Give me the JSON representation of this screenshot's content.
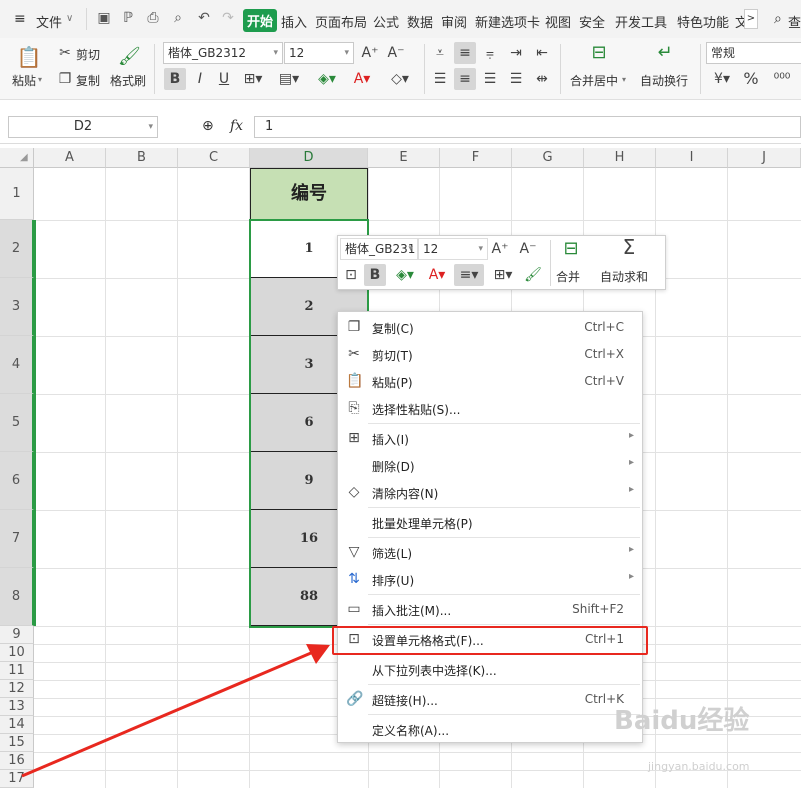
{
  "menubar": {
    "file_label": "文件",
    "tabs": [
      "开始",
      "插入",
      "页面布局",
      "公式",
      "数据",
      "审阅",
      "新建选项卡",
      "视图",
      "安全",
      "开发工具",
      "特色功能",
      "文"
    ],
    "active_tab": "开始",
    "search_label": "查"
  },
  "ribbon": {
    "paste_label": "粘贴",
    "cut_label": "剪切",
    "copy_label": "复制",
    "format_painter_label": "格式刷",
    "font_name": "楷体_GB2312",
    "font_size": "12",
    "merge_label": "合并居中",
    "wrap_label": "自动换行",
    "number_format": "常规",
    "percent_symbol": "%"
  },
  "formula_bar": {
    "name_box": "D2",
    "fx_label": "fx",
    "value": "1"
  },
  "sheet": {
    "columns": [
      "A",
      "B",
      "C",
      "D",
      "E",
      "F",
      "G",
      "H",
      "I",
      "J"
    ],
    "selected_column": "D",
    "header_cell": "编号",
    "d_values": [
      "1",
      "2",
      "3",
      "6",
      "9",
      "16",
      "88"
    ],
    "row_labels": [
      "1",
      "2",
      "3",
      "4",
      "5",
      "6",
      "7",
      "8",
      "9",
      "10",
      "11",
      "12",
      "13",
      "14",
      "15",
      "16",
      "17"
    ]
  },
  "mini_toolbar": {
    "font_name": "楷体_GB231",
    "font_size": "12",
    "merge_label": "合并",
    "autosum_label": "自动求和"
  },
  "context_menu": {
    "items": [
      {
        "label": "复制(C)",
        "shortcut": "Ctrl+C",
        "icon": "copy-icon"
      },
      {
        "label": "剪切(T)",
        "shortcut": "Ctrl+X",
        "icon": "scissors-icon"
      },
      {
        "label": "粘贴(P)",
        "shortcut": "Ctrl+V",
        "icon": "paste-icon"
      },
      {
        "label": "选择性粘贴(S)...",
        "shortcut": "",
        "icon": "paste-special-icon"
      },
      {
        "label": "插入(I)",
        "shortcut": "",
        "icon": "insert-icon"
      },
      {
        "label": "删除(D)",
        "shortcut": "",
        "icon": ""
      },
      {
        "label": "清除内容(N)",
        "shortcut": "",
        "icon": "eraser-icon"
      },
      {
        "label": "批量处理单元格(P)",
        "shortcut": "",
        "icon": ""
      },
      {
        "label": "筛选(L)",
        "shortcut": "",
        "icon": "filter-icon"
      },
      {
        "label": "排序(U)",
        "shortcut": "",
        "icon": "sort-icon"
      },
      {
        "label": "插入批注(M)...",
        "shortcut": "Shift+F2",
        "icon": "comment-icon"
      },
      {
        "label": "设置单元格格式(F)...",
        "shortcut": "Ctrl+1",
        "icon": "format-cells-icon"
      },
      {
        "label": "从下拉列表中选择(K)...",
        "shortcut": "",
        "icon": ""
      },
      {
        "label": "超链接(H)...",
        "shortcut": "Ctrl+K",
        "icon": "link-icon"
      },
      {
        "label": "定义名称(A)...",
        "shortcut": "",
        "icon": ""
      }
    ]
  },
  "watermark": {
    "text": "Baidu经验",
    "url": "jingyan.baidu.com"
  },
  "colors": {
    "accent_green": "#1e9c4e",
    "selection_green": "#2b9b45",
    "header_fill": "#c6e0b4",
    "highlight_red": "#e8281f"
  }
}
